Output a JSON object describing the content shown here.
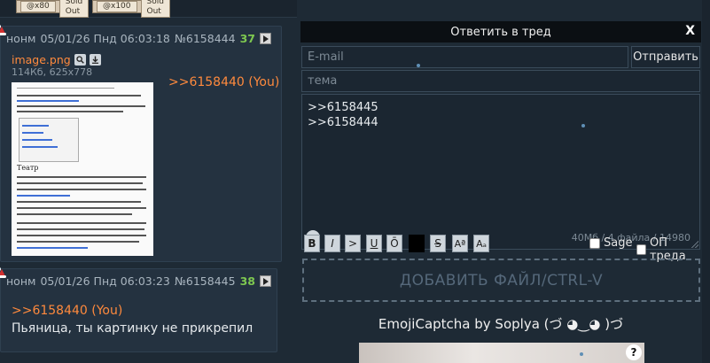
{
  "top_strip": {
    "cells": [
      "@x80",
      "Sold Out",
      "@x100",
      "Sold Out"
    ]
  },
  "posts": [
    {
      "name": "нонм",
      "date": "05/01/26 Пнд 06:03:18",
      "number": "№6158444",
      "replies": "37",
      "file": {
        "name": "image.png",
        "meta": "114Кб, 625x778"
      },
      "thumb_heading": "Театр",
      "quote": ">>6158440 (You)",
      "body": ""
    },
    {
      "name": "нонм",
      "date": "05/01/26 Пнд 06:03:23",
      "number": "№6158445",
      "replies": "38",
      "quote": ">>6158440 (You)",
      "body": "Пьяница, ты картинку не прикрепил"
    }
  ],
  "form": {
    "title": "Ответить в тред",
    "close": "X",
    "email_placeholder": "E-mail",
    "send_label": "Отправить",
    "subject_placeholder": "тема",
    "comment_lines": [
      ">>6158445",
      ">>6158444"
    ],
    "counter": "40Мб / 4 файла / 14980",
    "format_buttons": [
      "B",
      "I",
      ">",
      "U",
      "Ō",
      "",
      "S",
      "Aª",
      "Aₐ"
    ],
    "sage_label": "Sage",
    "op_label": "ОП треда",
    "dropzone_label": "ДОБАВИТЬ ФАЙЛ/CTRL-V",
    "captcha_title": "EmojiCaptcha by Soplya (づ ◕‿◕ )づ",
    "captcha_help": "?"
  },
  "colors": {
    "background": "#1e2a35",
    "post_bg": "#243240",
    "link": "#ff8a3d",
    "reply_count": "#7ec850"
  }
}
